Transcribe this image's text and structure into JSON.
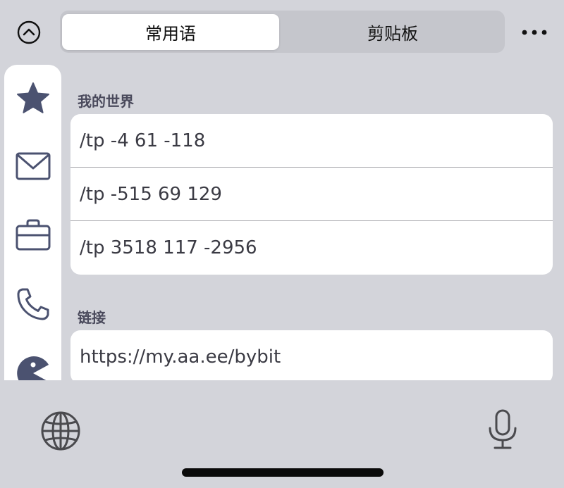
{
  "header": {
    "tabs": [
      {
        "label": "常用语",
        "active": true
      },
      {
        "label": "剪贴板",
        "active": false
      }
    ]
  },
  "sidebar": {
    "icons": [
      "star-icon",
      "mail-icon",
      "briefcase-icon",
      "phone-icon",
      "pacman-icon"
    ],
    "accent_color": "#4b5270"
  },
  "sections": [
    {
      "title": "我的世界",
      "items": [
        "/tp -4 61 -118",
        "/tp -515 69 129",
        "/tp 3518 117 -2956"
      ]
    },
    {
      "title": "链接",
      "items": [
        "https://my.aa.ee/bybit"
      ]
    }
  ],
  "toolbar": {
    "icons": [
      "globe-icon",
      "microphone-icon"
    ]
  },
  "colors": {
    "background": "#d3d4da",
    "card": "#ffffff",
    "segment_track": "#c5c6cc",
    "text": "#3b3b44",
    "section_title": "#4a4a5c"
  }
}
